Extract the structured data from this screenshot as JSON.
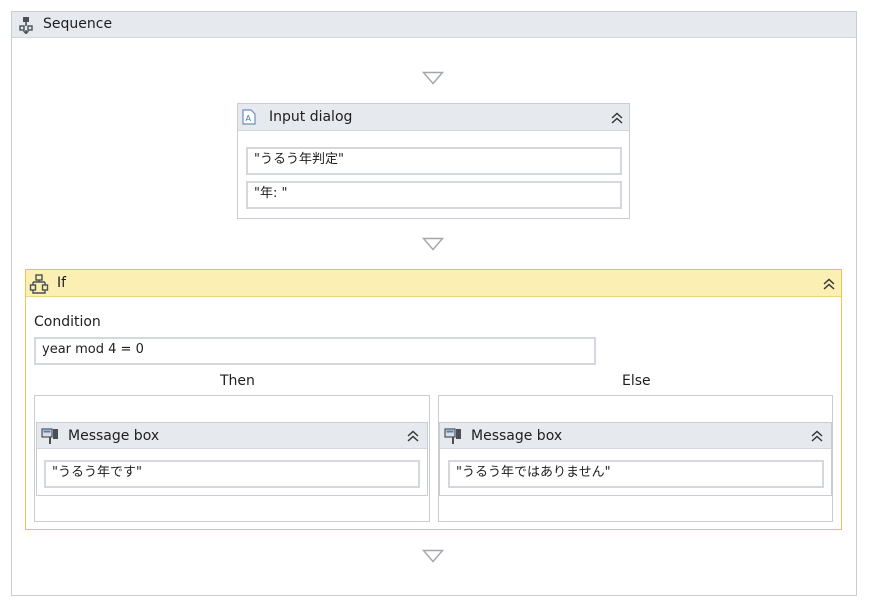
{
  "sequence": {
    "title": "Sequence"
  },
  "input_dialog": {
    "title": "Input dialog",
    "title_field": "\"うるう年判定\"",
    "label_field": "\"年: \""
  },
  "if_block": {
    "title": "If",
    "condition_label": "Condition",
    "condition_value": "year mod 4 = 0",
    "then_label": "Then",
    "else_label": "Else",
    "then_activity": {
      "title": "Message box",
      "text": "\"うるう年です\""
    },
    "else_activity": {
      "title": "Message box",
      "text": "\"うるう年ではありません\""
    }
  },
  "icons": {
    "sequence": "sequence-icon",
    "input_dialog": "input-dialog-icon",
    "if": "if-icon",
    "message_box": "message-box-icon",
    "collapse": "collapse-chevrons-icon",
    "drop_target": "drop-target-triangle-icon"
  },
  "colors": {
    "header_gray": "#e6e9ee",
    "if_header_yellow": "#fcefb3",
    "if_border": "#e7c84d",
    "field_border": "#d4d7de"
  }
}
